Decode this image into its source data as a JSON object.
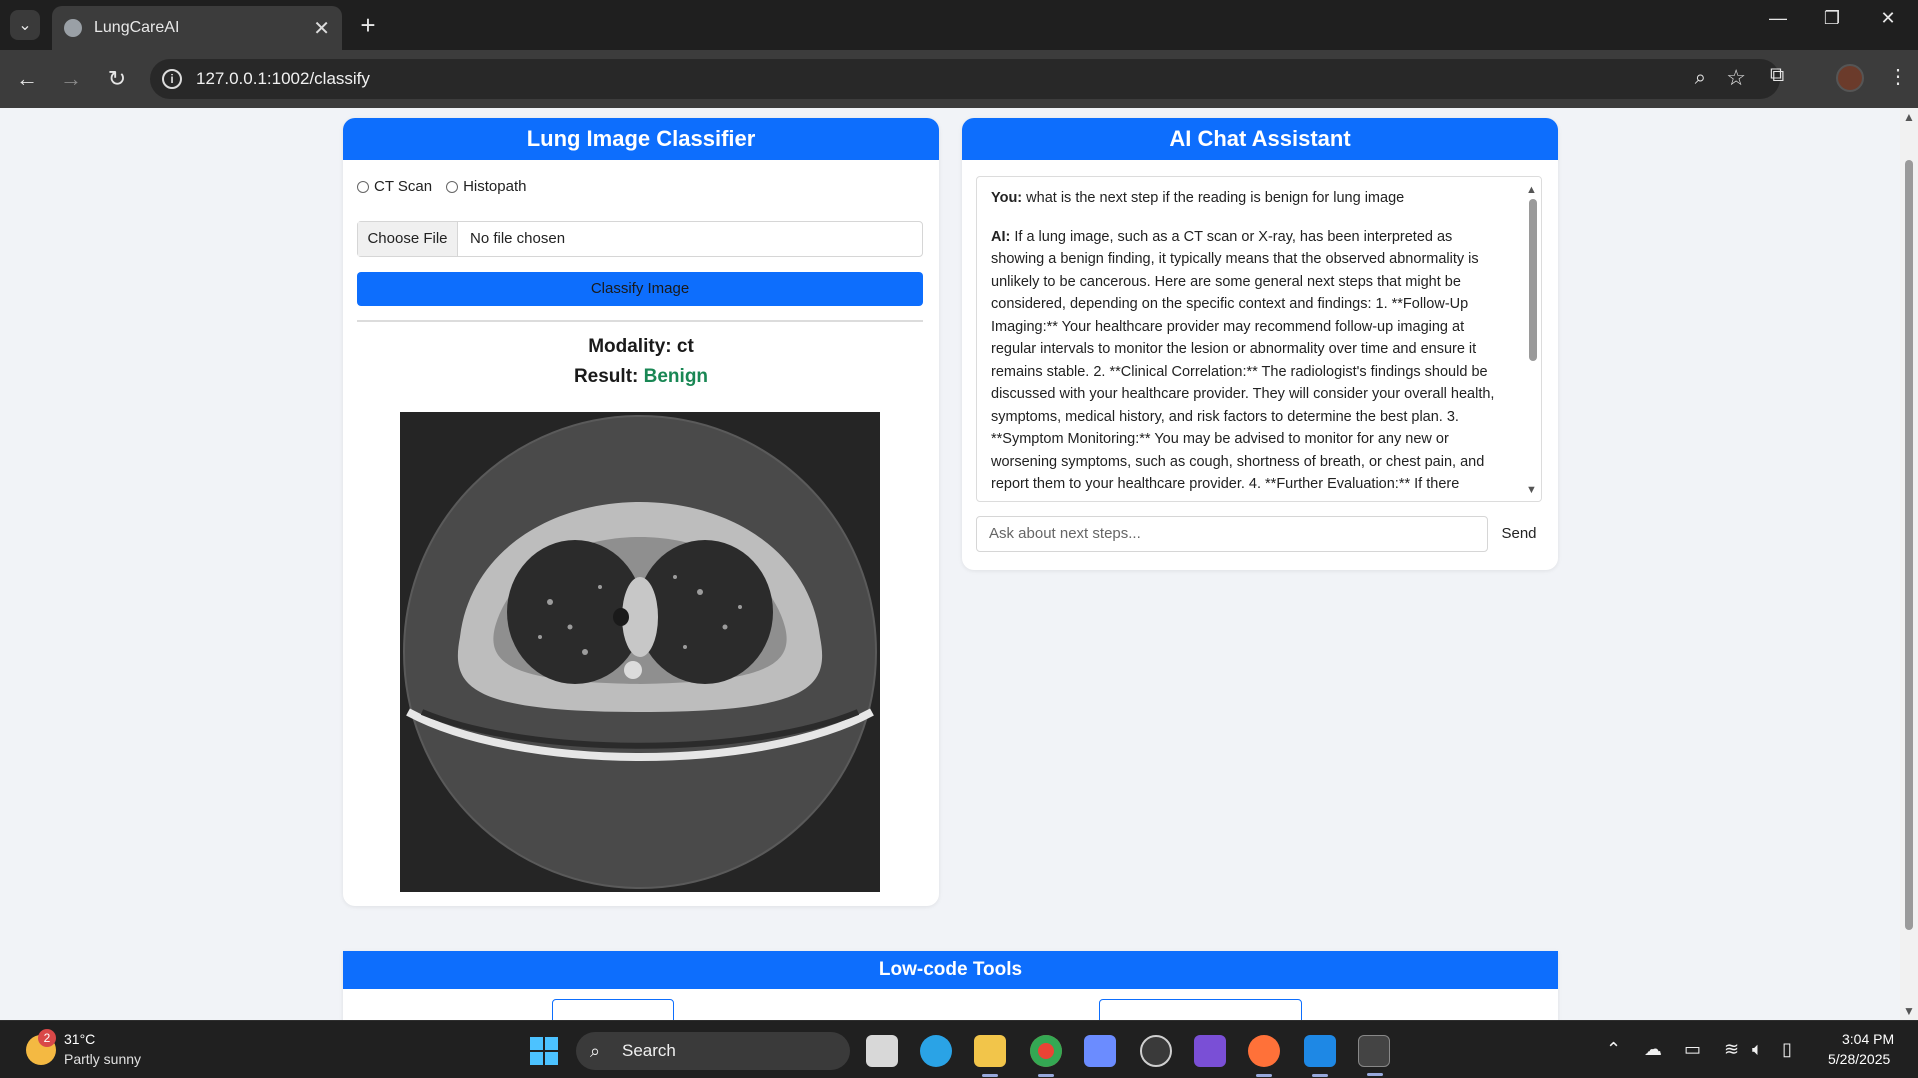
{
  "browser": {
    "tab_title": "LungCareAI",
    "url": "127.0.0.1:1002/classify"
  },
  "classifier": {
    "title": "Lung Image Classifier",
    "modality_options": [
      "CT Scan",
      "Histopath"
    ],
    "choose_file_label": "Choose File",
    "file_status": "No file chosen",
    "classify_button": "Classify Image",
    "modality_label": "Modality:",
    "modality_value": "ct",
    "result_label": "Result:",
    "result_value": "Benign",
    "result_color": "#198754"
  },
  "chat": {
    "title": "AI Chat Assistant",
    "messages": [
      {
        "speaker": "You:",
        "text": "what is the next step if the reading is benign for lung image"
      },
      {
        "speaker": "AI:",
        "text": "If a lung image, such as a CT scan or X-ray, has been interpreted as showing a benign finding, it typically means that the observed abnormality is unlikely to be cancerous. Here are some general next steps that might be considered, depending on the specific context and findings: 1. **Follow-Up Imaging:** Your healthcare provider may recommend follow-up imaging at regular intervals to monitor the lesion or abnormality over time and ensure it remains stable. 2. **Clinical Correlation:** The radiologist's findings should be discussed with your healthcare provider. They will consider your overall health, symptoms, medical history, and risk factors to determine the best plan. 3. **Symptom Monitoring:** You may be advised to monitor for any new or worsening symptoms, such as cough, shortness of breath, or chest pain, and report them to your healthcare provider. 4. **Further Evaluation:** If there"
      }
    ],
    "input_placeholder": "Ask about next steps...",
    "send_label": "Send"
  },
  "lowcode": {
    "title": "Low-code Tools"
  },
  "taskbar": {
    "weather_badge": "2",
    "temperature": "31°C",
    "weather": "Partly sunny",
    "search_label": "Search",
    "time": "3:04 PM",
    "date": "5/28/2025"
  },
  "colors": {
    "primary": "#0d6efd",
    "benign": "#198754"
  }
}
